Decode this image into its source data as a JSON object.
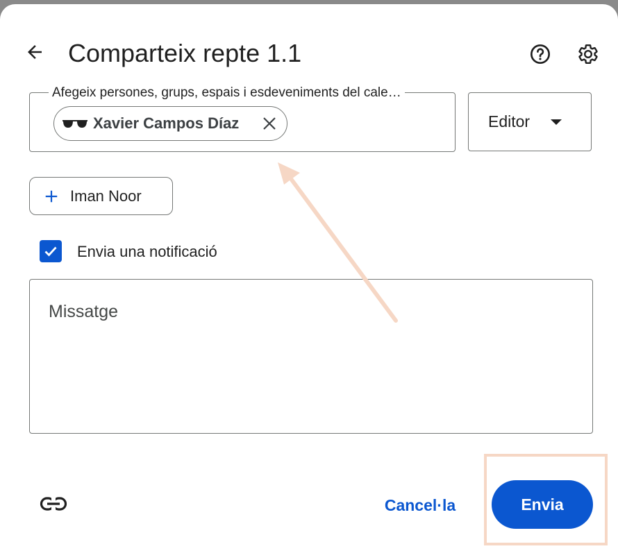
{
  "dialog": {
    "title": "Comparteix repte 1.1",
    "back_icon": "arrow-left-icon",
    "help_icon": "help-circle-icon",
    "settings_icon": "gear-icon"
  },
  "people_field": {
    "label": "Afegeix persones, grups, espais i esdeveniments del cale…",
    "chips": [
      {
        "name": "Xavier Campos Díaz",
        "avatar_icon": "sunglasses-icon",
        "remove_icon": "close-icon"
      }
    ]
  },
  "role_select": {
    "value": "Editor",
    "caret_icon": "caret-down-icon"
  },
  "suggestion": {
    "label": "Iman Noor",
    "icon": "plus-icon"
  },
  "notify": {
    "label": "Envia una notificació",
    "checked": true
  },
  "message": {
    "placeholder": "Missatge"
  },
  "footer": {
    "link_icon": "link-icon",
    "cancel_label": "Cancel·la",
    "send_label": "Envia"
  },
  "colors": {
    "accent": "#0b57d0",
    "annotation": "#f6d7c5",
    "border": "#747775"
  }
}
